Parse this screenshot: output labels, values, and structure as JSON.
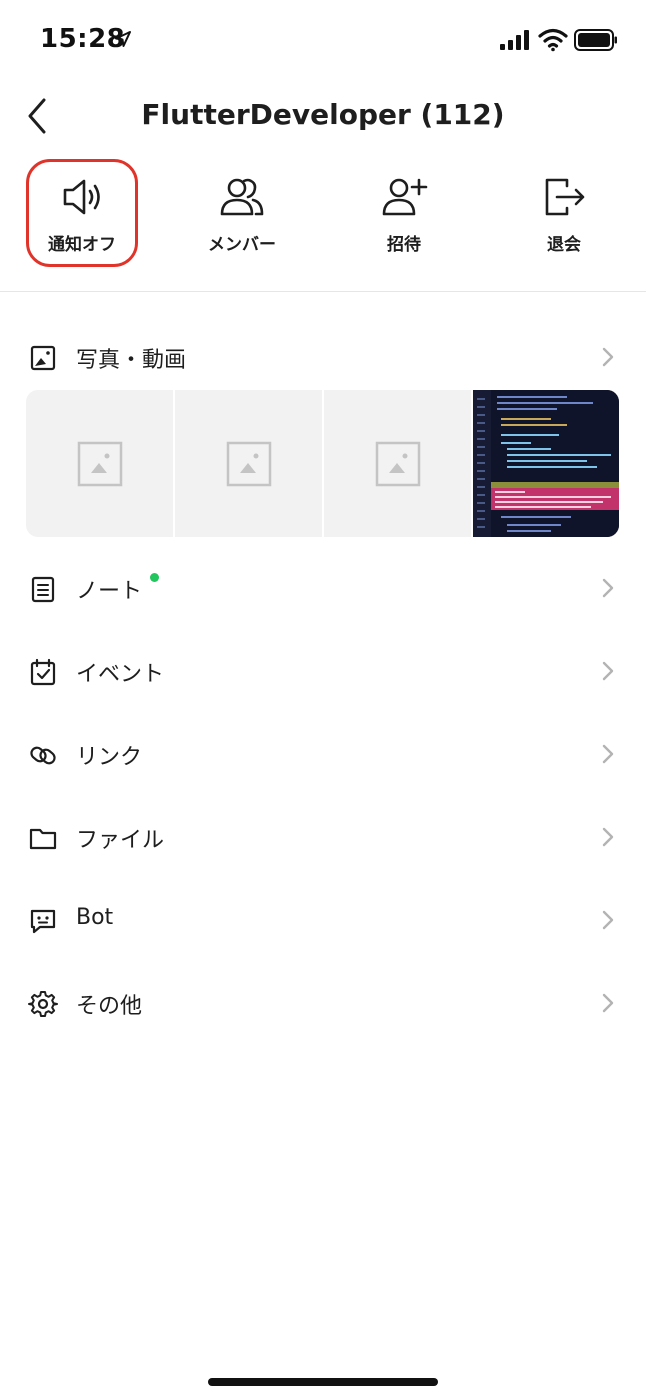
{
  "status_bar": {
    "time": "15:28"
  },
  "header": {
    "title": "FlutterDeveloper (112)"
  },
  "actions": [
    {
      "label": "通知オフ",
      "icon": "speaker-icon",
      "highlighted": true
    },
    {
      "label": "メンバー",
      "icon": "members-icon",
      "highlighted": false
    },
    {
      "label": "招待",
      "icon": "invite-icon",
      "highlighted": false
    },
    {
      "label": "退会",
      "icon": "leave-icon",
      "highlighted": false
    }
  ],
  "menu": {
    "photos": {
      "label": "写真・動画",
      "icon": "photo-icon"
    },
    "items": [
      {
        "label": "ノート",
        "icon": "note-icon",
        "new_badge": true
      },
      {
        "label": "イベント",
        "icon": "calendar-icon",
        "new_badge": false
      },
      {
        "label": "リンク",
        "icon": "link-icon",
        "new_badge": false
      },
      {
        "label": "ファイル",
        "icon": "folder-icon",
        "new_badge": false
      },
      {
        "label": "Bot",
        "icon": "bot-icon",
        "new_badge": false
      },
      {
        "label": "その他",
        "icon": "gear-icon",
        "new_badge": false
      }
    ]
  },
  "colors": {
    "highlight": "#e0342a",
    "badge": "#22c55e",
    "text": "#1e1e1e",
    "chevron": "#b3b3b3",
    "thumb_bg": "#f2f2f2"
  }
}
